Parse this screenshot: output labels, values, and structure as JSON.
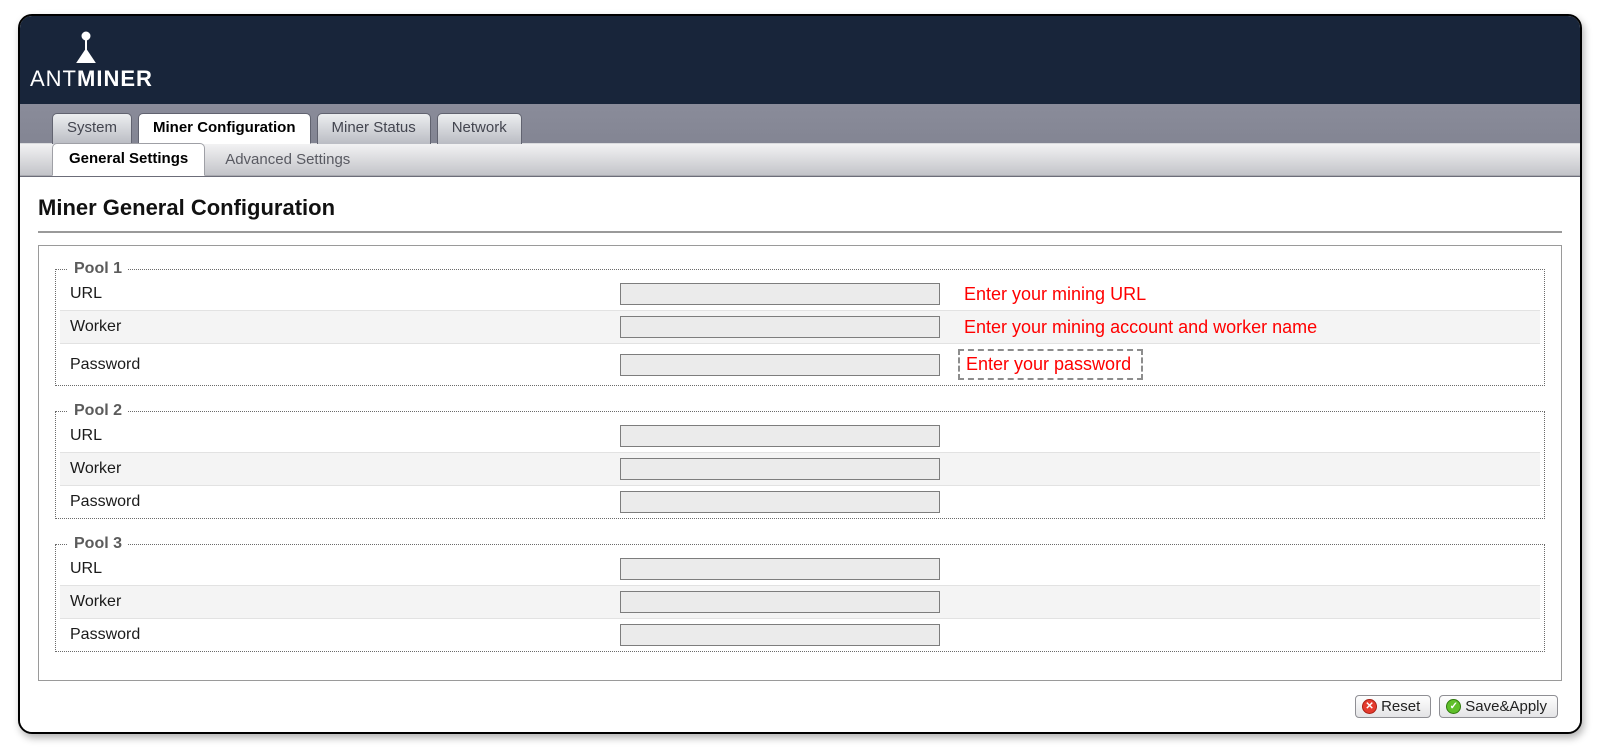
{
  "brand": {
    "thin": "ANT",
    "bold": "MINER"
  },
  "main_tabs": [
    {
      "label": "System",
      "active": false
    },
    {
      "label": "Miner Configuration",
      "active": true
    },
    {
      "label": "Miner Status",
      "active": false
    },
    {
      "label": "Network",
      "active": false
    }
  ],
  "sub_tabs": [
    {
      "label": "General Settings",
      "active": true
    },
    {
      "label": "Advanced Settings",
      "active": false
    }
  ],
  "page_title": "Miner General Configuration",
  "pools": [
    {
      "legend": "Pool 1",
      "rows": [
        {
          "label": "URL",
          "value": "",
          "hint": "Enter your mining URL",
          "hint_dashed": false,
          "alt": false
        },
        {
          "label": "Worker",
          "value": "",
          "hint": "Enter your mining account and worker name",
          "hint_dashed": false,
          "alt": true
        },
        {
          "label": "Password",
          "value": "",
          "hint": "Enter your password",
          "hint_dashed": true,
          "alt": false
        }
      ]
    },
    {
      "legend": "Pool 2",
      "rows": [
        {
          "label": "URL",
          "value": "",
          "hint": "",
          "hint_dashed": false,
          "alt": false
        },
        {
          "label": "Worker",
          "value": "",
          "hint": "",
          "hint_dashed": false,
          "alt": true
        },
        {
          "label": "Password",
          "value": "",
          "hint": "",
          "hint_dashed": false,
          "alt": false
        }
      ]
    },
    {
      "legend": "Pool 3",
      "rows": [
        {
          "label": "URL",
          "value": "",
          "hint": "",
          "hint_dashed": false,
          "alt": false
        },
        {
          "label": "Worker",
          "value": "",
          "hint": "",
          "hint_dashed": false,
          "alt": true
        },
        {
          "label": "Password",
          "value": "",
          "hint": "",
          "hint_dashed": false,
          "alt": false
        }
      ]
    }
  ],
  "buttons": {
    "reset": "Reset",
    "save": "Save&Apply"
  }
}
